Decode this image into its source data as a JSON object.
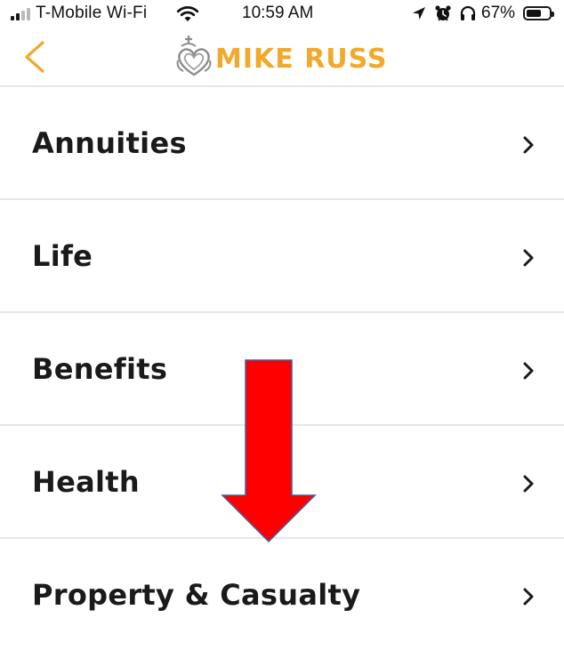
{
  "status_bar": {
    "carrier": "T-Mobile Wi-Fi",
    "time": "10:59 AM",
    "battery_percent": "67%",
    "battery_level": 0.67,
    "signal_bars": 4,
    "signal_bars_active": 2,
    "icons": [
      "location-arrow-icon",
      "alarm-clock-icon",
      "headphones-icon"
    ]
  },
  "header": {
    "back_icon": "chevron-left-icon",
    "logo_text": "MIKE RUSS",
    "logo_icon": "crowned-heart-logo-icon"
  },
  "menu": {
    "items": [
      {
        "label": "Annuities",
        "icon": "chevron-right-icon"
      },
      {
        "label": "Life",
        "icon": "chevron-right-icon"
      },
      {
        "label": "Benefits",
        "icon": "chevron-right-icon"
      },
      {
        "label": "Health",
        "icon": "chevron-right-icon"
      },
      {
        "label": "Property & Casualty",
        "icon": "chevron-right-icon"
      }
    ]
  },
  "annotation": {
    "type": "down-arrow",
    "color": "#ff0000"
  },
  "colors": {
    "accent": "#f0a92d",
    "text": "#1a1a1a",
    "divider": "#e6e6e6",
    "annotation": "#ff0000"
  }
}
